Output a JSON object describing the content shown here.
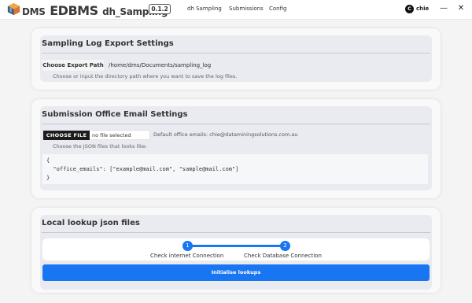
{
  "header": {
    "brand_prefix": "DMS",
    "brand_main": "EDBMS",
    "brand_suffix": "dh_Sampling",
    "version": "0.1.2",
    "nav": [
      "dh Sampling",
      "Submissions",
      "Config"
    ],
    "user": {
      "initial": "C",
      "name": "chie"
    },
    "window_controls": {
      "minimize": "—",
      "close": "✕"
    },
    "logo_icon": "cube-logo-icon"
  },
  "sampling_log": {
    "title": "Sampling Log Export Settings",
    "button_label": "Choose Export Path",
    "path": "/home/dms/Documents/sampling_log",
    "hint": "Choose or input the directory path where you want to save the log files."
  },
  "email": {
    "title": "Submission Office Email Settings",
    "file_button": "CHOOSE FILE",
    "file_status": "no file selected",
    "default_label": "Default office emails: chie@dataminingsolutions.com.au",
    "hint": "Choose the JSON files that looks like:",
    "code_lines": [
      "{",
      "  \"office_emails\": [\"example@mail.com\", \"sample@mail.com\"]",
      "}"
    ]
  },
  "lookup": {
    "title": "Local lookup json files",
    "steps": [
      {
        "number": "1",
        "label": "Check internet Connection"
      },
      {
        "number": "2",
        "label": "Check Database Connection"
      }
    ],
    "init_button": "Initialise lookups"
  },
  "colors": {
    "accent": "#1976f2",
    "page_bg": "#f4f4f4",
    "card_inner": "#e9ebf0"
  }
}
